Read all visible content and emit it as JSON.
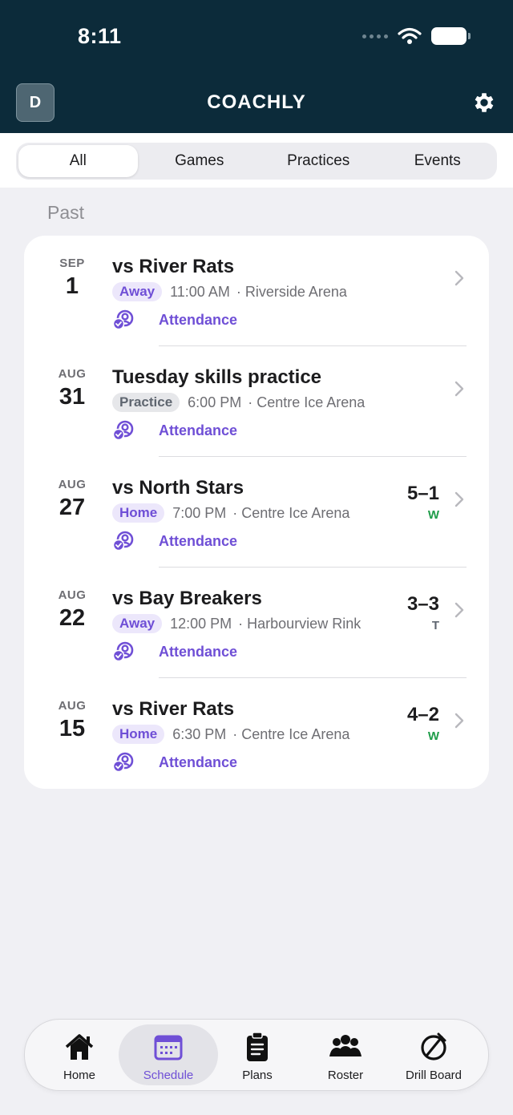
{
  "status": {
    "time": "8:11"
  },
  "header": {
    "avatar_initial": "D",
    "title": "COACHLY"
  },
  "segments": [
    "All",
    "Games",
    "Practices",
    "Events"
  ],
  "section": "Past",
  "events": [
    {
      "month": "SEP",
      "day": "1",
      "title": "vs River Rats",
      "tag": "Away",
      "time": "11:00 AM",
      "venue": "· Riverside Arena",
      "attendance": "Attendance",
      "score": "",
      "result": ""
    },
    {
      "month": "AUG",
      "day": "31",
      "title": "Tuesday skills practice",
      "tag": "Practice",
      "time": "6:00 PM",
      "venue": "· Centre Ice Arena",
      "attendance": "Attendance",
      "score": "",
      "result": ""
    },
    {
      "month": "AUG",
      "day": "27",
      "title": "vs North Stars",
      "tag": "Home",
      "time": "7:00 PM",
      "venue": "· Centre Ice Arena",
      "attendance": "Attendance",
      "score": "5–1",
      "result": "W"
    },
    {
      "month": "AUG",
      "day": "22",
      "title": "vs Bay Breakers",
      "tag": "Away",
      "time": "12:00 PM",
      "venue": "· Harbourview Rink",
      "attendance": "Attendance",
      "score": "3–3",
      "result": "T"
    },
    {
      "month": "AUG",
      "day": "15",
      "title": "vs River Rats",
      "tag": "Home",
      "time": "6:30 PM",
      "venue": "· Centre Ice Arena",
      "attendance": "Attendance",
      "score": "4–2",
      "result": "W"
    }
  ],
  "tabs": [
    "Home",
    "Schedule",
    "Plans",
    "Roster",
    "Drill Board"
  ],
  "colors": {
    "header_bg": "#0c2b3a",
    "accent": "#6f4fd6",
    "win": "#1f9d4a",
    "tie": "#5f6670"
  },
  "icons": {
    "settings": "gear-icon",
    "attendance": "attendance-icon",
    "chevron": "chevron-right-icon",
    "home": "home-icon",
    "schedule": "calendar-icon",
    "plans": "clipboard-icon",
    "roster": "group-icon",
    "drill_board": "whistle-icon"
  }
}
